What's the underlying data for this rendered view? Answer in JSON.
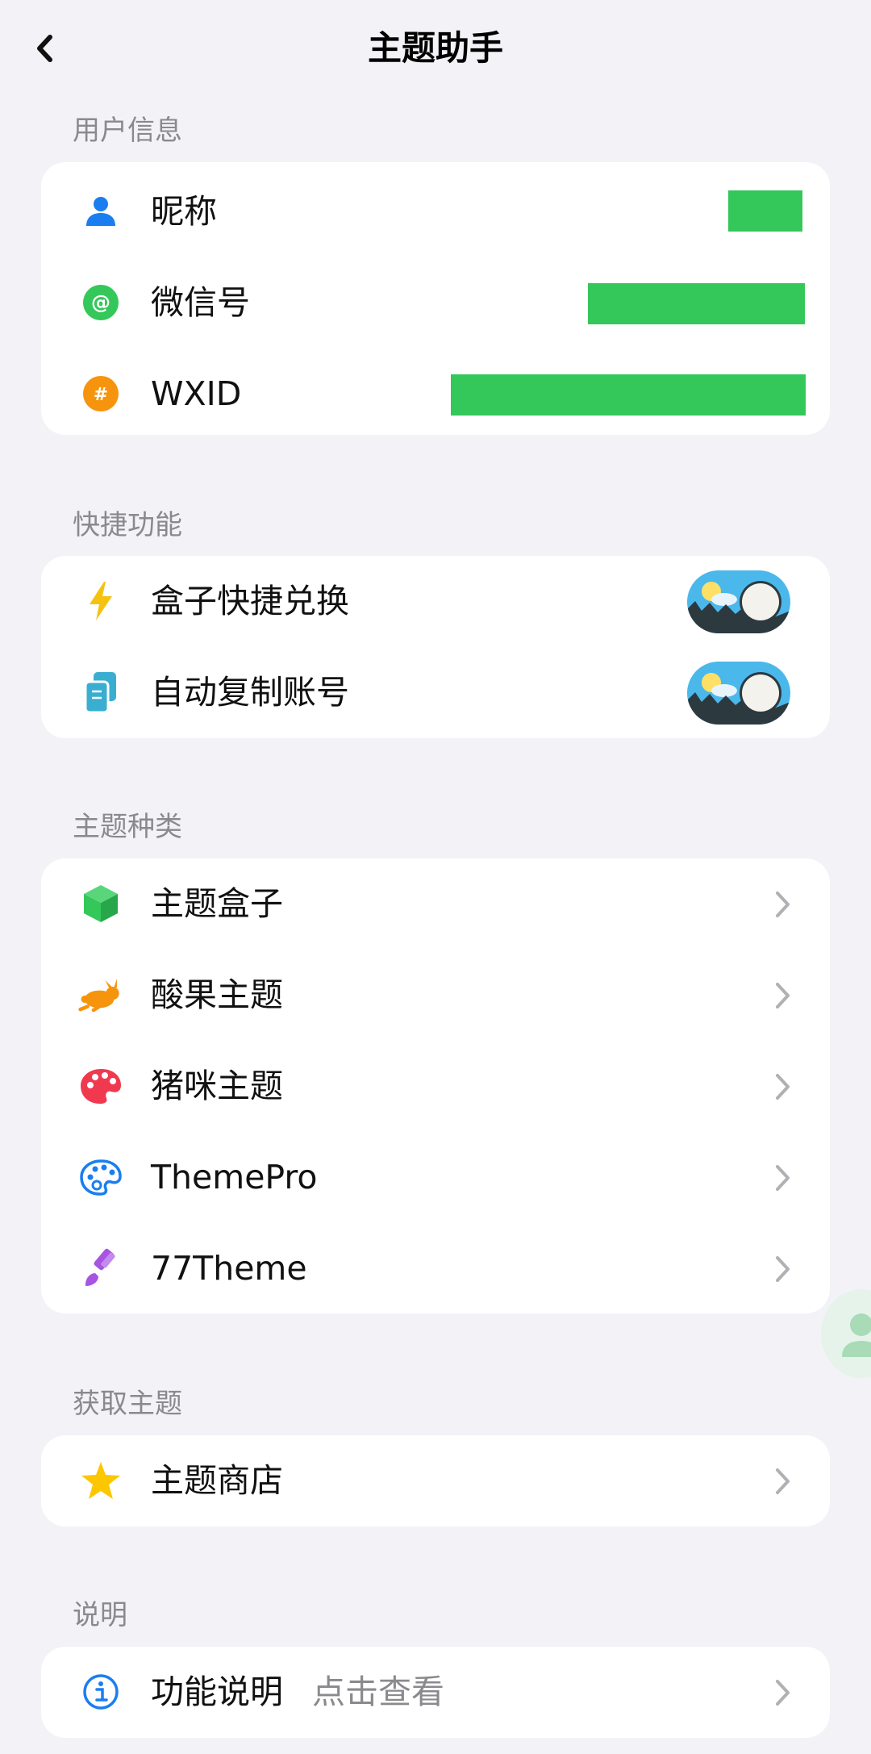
{
  "header": {
    "title": "主题助手"
  },
  "sections": {
    "user_info": {
      "label": "用户信息",
      "rows": [
        {
          "label": "昵称",
          "icon": "person-icon"
        },
        {
          "label": "微信号",
          "icon": "at-icon"
        },
        {
          "label": "WXID",
          "icon": "hash-icon"
        }
      ]
    },
    "shortcuts": {
      "label": "快捷功能",
      "rows": [
        {
          "label": "盒子快捷兑换",
          "icon": "bolt-icon",
          "enabled": true
        },
        {
          "label": "自动复制账号",
          "icon": "copy-icon",
          "enabled": true
        }
      ]
    },
    "theme_types": {
      "label": "主题种类",
      "rows": [
        {
          "label": "主题盒子",
          "icon": "cube-icon"
        },
        {
          "label": "酸果主题",
          "icon": "rabbit-icon"
        },
        {
          "label": "猪咪主题",
          "icon": "palette-icon"
        },
        {
          "label": "ThemePro",
          "icon": "palette-outline-icon"
        },
        {
          "label": "77Theme",
          "icon": "brush-icon"
        }
      ]
    },
    "get_theme": {
      "label": "获取主题",
      "rows": [
        {
          "label": "主题商店",
          "icon": "star-icon"
        }
      ]
    },
    "about": {
      "label": "说明",
      "rows": [
        {
          "label": "功能说明",
          "hint": "点击查看",
          "icon": "info-icon"
        }
      ]
    }
  },
  "colors": {
    "background": "#f2f2f7",
    "card": "#ffffff",
    "redaction": "#34c759",
    "person": "#1a7ef0",
    "at": "#34c759",
    "hash": "#f7940d",
    "bolt": "#f5c30f",
    "copy": "#3aaed0",
    "cube": "#34c759",
    "rabbit": "#f7940d",
    "palette": "#f0394f",
    "palette_outline": "#1a7ef0",
    "brush": "#a755e0",
    "star": "#fcc700",
    "info": "#1a7ef0"
  }
}
